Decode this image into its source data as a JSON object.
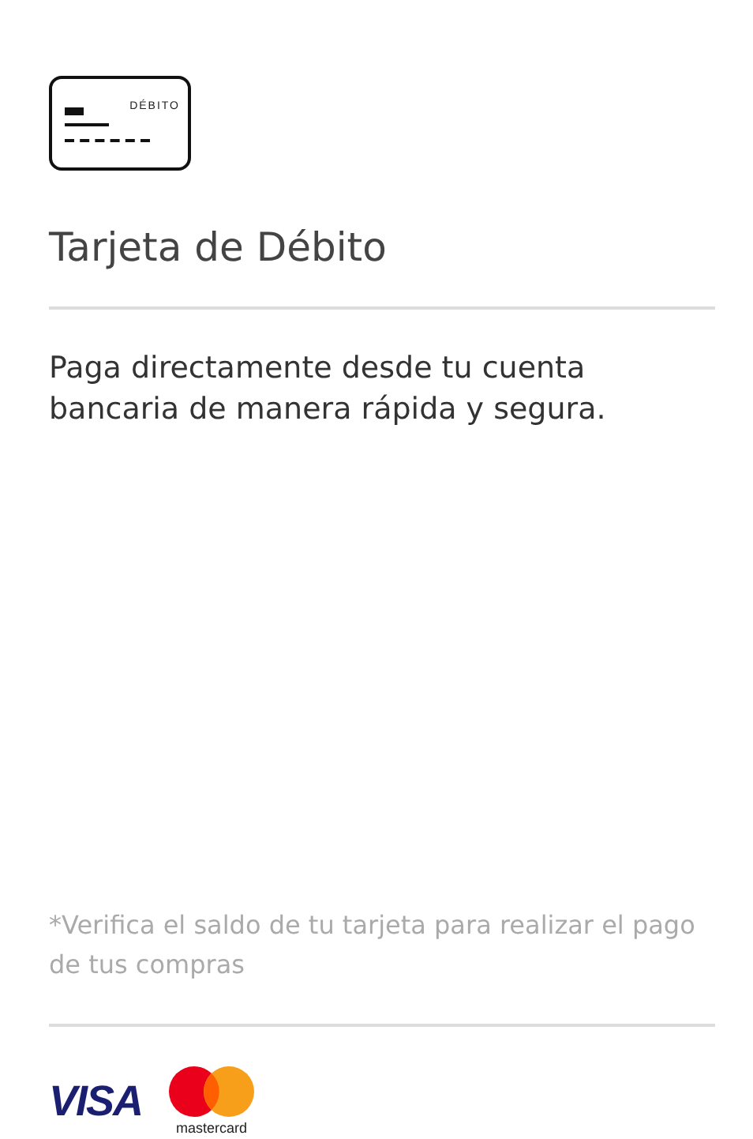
{
  "card_icon": {
    "label": "DÉBITO"
  },
  "title": "Tarjeta de Débito",
  "description": "Paga directamente desde tu cuenta bancaria de manera rápida y segura.",
  "note": "*Verifica el saldo de tu tarjeta para realizar el pago de tus compras",
  "brands": [
    {
      "kind": "visa",
      "text": "VISA"
    },
    {
      "kind": "mastercard",
      "text": "mastercard"
    }
  ]
}
